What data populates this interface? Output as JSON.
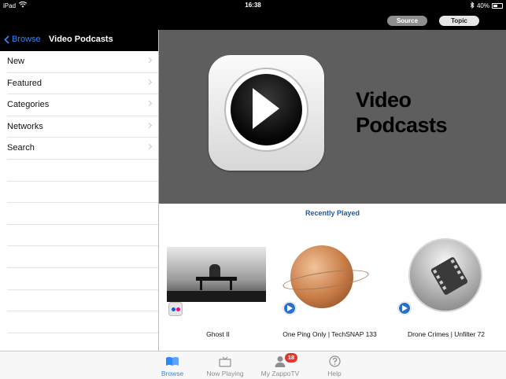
{
  "status_bar": {
    "device": "iPad",
    "time": "16:38",
    "battery": "40%"
  },
  "segments": {
    "source": "Source",
    "topic": "Topic"
  },
  "left_panel": {
    "back_label": "Browse",
    "title": "Video Podcasts",
    "items": [
      {
        "label": "New"
      },
      {
        "label": "Featured"
      },
      {
        "label": "Categories"
      },
      {
        "label": "Networks"
      },
      {
        "label": "Search"
      }
    ]
  },
  "banner": {
    "line1": "Video",
    "line2": "Podcasts"
  },
  "recently_played": {
    "heading": "Recently Played",
    "items": [
      {
        "caption": "Ghost II",
        "thumb_icon": "bench-photo",
        "source_icon": "flickr-icon"
      },
      {
        "caption": "One Ping Only | TechSNAP 133",
        "thumb_icon": "planet-rocket-art",
        "source_icon": "play-icon"
      },
      {
        "caption": "Drone Crimes | Unfilter 72",
        "thumb_icon": "film-strip-icon",
        "source_icon": "play-icon"
      }
    ]
  },
  "tabbar": {
    "tabs": [
      {
        "label": "Browse",
        "active": true,
        "icon": "book-icon"
      },
      {
        "label": "Now Playing",
        "active": false,
        "icon": "tv-icon"
      },
      {
        "label": "My ZappoTV",
        "active": false,
        "icon": "person-icon",
        "badge": "18"
      },
      {
        "label": "Help",
        "active": false,
        "icon": "question-icon"
      }
    ]
  },
  "colors": {
    "accent": "#2b86ff",
    "badge": "#e2352b",
    "banner_bg": "#5e5e5e",
    "heading": "#1d5aa8"
  }
}
